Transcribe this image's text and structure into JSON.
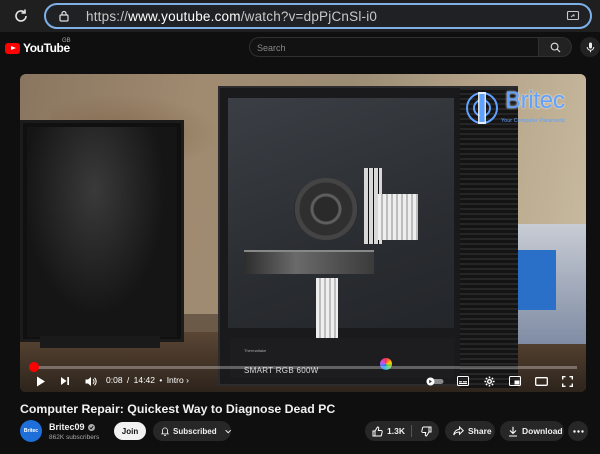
{
  "browser": {
    "url_prefix": "https://",
    "url_domain": "www.youtube.com",
    "url_path": "/watch?v=dpPjCnSl-i0"
  },
  "header": {
    "logo_text": "YouTube",
    "country_code": "GB",
    "search_placeholder": "Search"
  },
  "video": {
    "brand_name": "Britec",
    "brand_tagline": "Your Computer Paramedic",
    "psu_label": "SMART RGB 600W",
    "psu_brand": "Thermaltake",
    "progress_fraction": 0.0094,
    "current_time": "0:08",
    "duration": "14:42",
    "time_separator": "/",
    "chapter": "Intro",
    "chapter_arrow": "›"
  },
  "meta": {
    "title": "Computer Repair: Quickest Way to Diagnose Dead PC",
    "channel_name": "Britec09",
    "avatar_text": "Britec",
    "subscribers": "862K subscribers",
    "join_label": "Join",
    "subscribed_label": "Subscribed",
    "likes": "1.3K",
    "share_label": "Share",
    "download_label": "Download"
  },
  "colors": {
    "accent": "#ff0000",
    "url_border": "#7fb0e8",
    "brand_blue": "#5ea1ff"
  }
}
